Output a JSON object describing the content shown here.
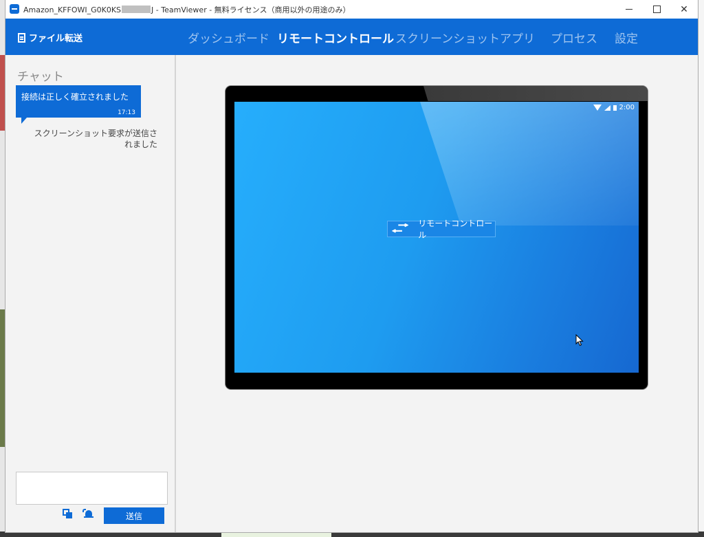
{
  "window": {
    "title_prefix": "Amazon_KFFOWI_G0K0KS",
    "title_suffix": "J - TeamViewer - 無料ライセンス（商用以外の用途のみ）"
  },
  "nav": {
    "file_transfer": "ファイル転送",
    "tabs": [
      {
        "label": "ダッシュボード",
        "active": false
      },
      {
        "label": "リモートコントロール",
        "active": true
      },
      {
        "label": "スクリーンショット",
        "active": false
      },
      {
        "label": "アプリ",
        "active": false
      },
      {
        "label": "プロセス",
        "active": false
      },
      {
        "label": "設定",
        "active": false
      }
    ]
  },
  "chat": {
    "title": "チャット",
    "message": "接続は正しく確立されました",
    "message_time": "17:13",
    "status": "スクリーンショット要求が送信されました",
    "send_label": "送信"
  },
  "device": {
    "clock": "2:00",
    "badge_label": "リモートコントロール"
  },
  "icons": [
    "document-icon",
    "screenshot-icon",
    "bell-icon",
    "wifi-icon",
    "signal-icon",
    "battery-icon",
    "swap-arrows-icon",
    "cursor-icon"
  ],
  "colors": {
    "accent": "#0e6bd6"
  }
}
